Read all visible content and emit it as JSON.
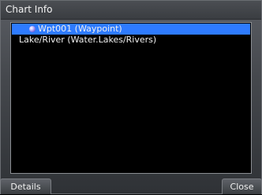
{
  "dialog": {
    "title": "Chart Info"
  },
  "list": {
    "items": [
      {
        "label": "Wpt001 (Waypoint)",
        "icon": "waypoint-icon",
        "selected": true
      },
      {
        "label": "Lake/River (Water.Lakes/Rivers)",
        "icon": "",
        "selected": false
      }
    ]
  },
  "buttons": {
    "details_label": "Details",
    "close_label": "Close"
  },
  "colors": {
    "selection": "#2e7bff",
    "list_background": "#000000",
    "text": "#f0f0f0"
  }
}
